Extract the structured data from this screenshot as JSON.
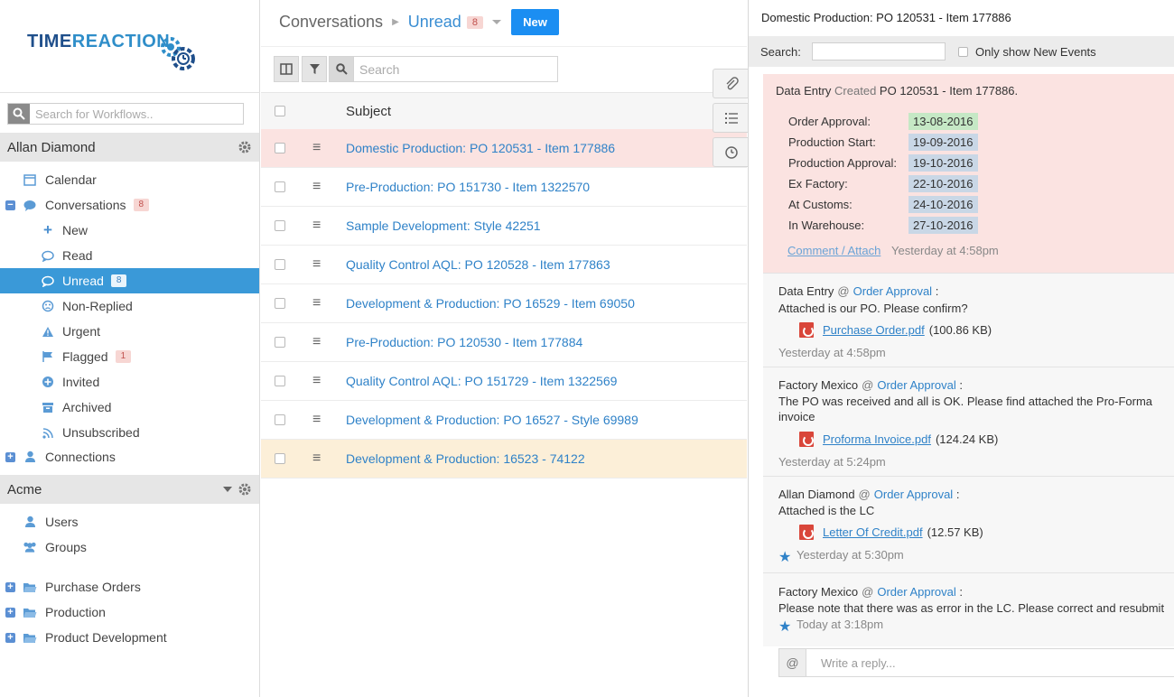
{
  "brand": {
    "logo_time": "TIME",
    "logo_reaction": "REACTION"
  },
  "sidebar": {
    "search_placeholder": "Search for Workflows..",
    "user_section": "Allan Diamond",
    "items": [
      {
        "label": "Calendar",
        "icon": "calendar-icon"
      },
      {
        "label": "Conversations",
        "icon": "chat-icon",
        "count": "8"
      },
      {
        "label": "New",
        "icon": "plus-icon"
      },
      {
        "label": "Read",
        "icon": "chat-outline-icon"
      },
      {
        "label": "Unread",
        "icon": "chat-bubble-icon",
        "count": "8"
      },
      {
        "label": "Non-Replied",
        "icon": "frown-icon"
      },
      {
        "label": "Urgent",
        "icon": "warning-icon"
      },
      {
        "label": "Flagged",
        "icon": "flag-icon",
        "count": "1"
      },
      {
        "label": "Invited",
        "icon": "plus-circle-icon"
      },
      {
        "label": "Archived",
        "icon": "archive-icon"
      },
      {
        "label": "Unsubscribed",
        "icon": "rss-icon"
      },
      {
        "label": "Connections",
        "icon": "user-icon"
      }
    ],
    "org_section": "Acme",
    "org_items": [
      {
        "label": "Users",
        "icon": "user-icon"
      },
      {
        "label": "Groups",
        "icon": "group-icon"
      },
      {
        "label": "Purchase Orders",
        "icon": "folder-icon"
      },
      {
        "label": "Production",
        "icon": "folder-icon"
      },
      {
        "label": "Product Development",
        "icon": "folder-icon"
      }
    ]
  },
  "main": {
    "breadcrumb_root": "Conversations",
    "breadcrumb_current": "Unread",
    "breadcrumb_count": "8",
    "new_button": "New",
    "search_placeholder": "Search",
    "column_subject": "Subject",
    "rows": [
      "Domestic Production: PO 120531 - Item 177886",
      "Pre-Production: PO 151730 - Item 1322570",
      "Sample Development: Style 42251",
      "Quality Control AQL: PO 120528 - Item 177863",
      "Development & Production: PO 16529 - Item 69050",
      "Pre-Production: PO 120530 - Item 177884",
      "Quality Control AQL: PO 151729 - Item 1322569",
      "Development & Production: PO 16527 - Style 69989",
      "Development & Production: 16523 - 74122"
    ]
  },
  "panel": {
    "title": "Domestic Production: PO 120531 - Item 177886",
    "search_label": "Search:",
    "filter_label": "Only show New Events",
    "event": {
      "actor": "Data Entry",
      "verb": "Created",
      "object": "PO 120531 - Item 177886.",
      "dates": [
        {
          "label": "Order Approval:",
          "value": "13-08-2016",
          "status": "done"
        },
        {
          "label": "Production Start:",
          "value": "19-09-2016",
          "status": "pending"
        },
        {
          "label": "Production Approval:",
          "value": "19-10-2016",
          "status": "pending"
        },
        {
          "label": "Ex Factory:",
          "value": "22-10-2016",
          "status": "pending"
        },
        {
          "label": "At Customs:",
          "value": "24-10-2016",
          "status": "pending"
        },
        {
          "label": "In Warehouse:",
          "value": "27-10-2016",
          "status": "pending"
        }
      ],
      "link": "Comment / Attach",
      "time": "Yesterday at 4:58pm"
    },
    "messages": [
      {
        "author": "Data Entry",
        "at": "@",
        "stage": "Order Approval",
        "colon": ":",
        "body": "Attached is our PO. Please confirm?",
        "file": "Purchase Order.pdf",
        "size": "(100.86 KB)",
        "time": "Yesterday at 4:58pm"
      },
      {
        "author": "Factory Mexico",
        "at": "@",
        "stage": "Order Approval",
        "colon": ":",
        "body": "The PO was received and all is OK. Please find attached the Pro-Forma invoice",
        "file": "Proforma Invoice.pdf",
        "size": "(124.24 KB)",
        "time": "Yesterday at 5:24pm"
      },
      {
        "author": "Allan Diamond",
        "at": "@",
        "stage": "Order Approval",
        "colon": ":",
        "body": "Attached is the LC",
        "file": "Letter Of Credit.pdf",
        "size": "(12.57 KB)",
        "time": "Yesterday at 5:30pm"
      },
      {
        "author": "Factory Mexico",
        "at": "@",
        "stage": "Order Approval",
        "colon": ":",
        "body": "Please note that there was as error in the LC. Please correct and resubmit",
        "time": "Today at 3:18pm"
      }
    ],
    "reply_at": "@",
    "reply_placeholder": "Write a reply..."
  },
  "colors": {
    "accent": "#3a99d8",
    "selected_row": "#fbe3e1",
    "highlight_row": "#fcefd8",
    "new_button": "#1b8ef2",
    "count_badge": "#f7d6d3"
  }
}
